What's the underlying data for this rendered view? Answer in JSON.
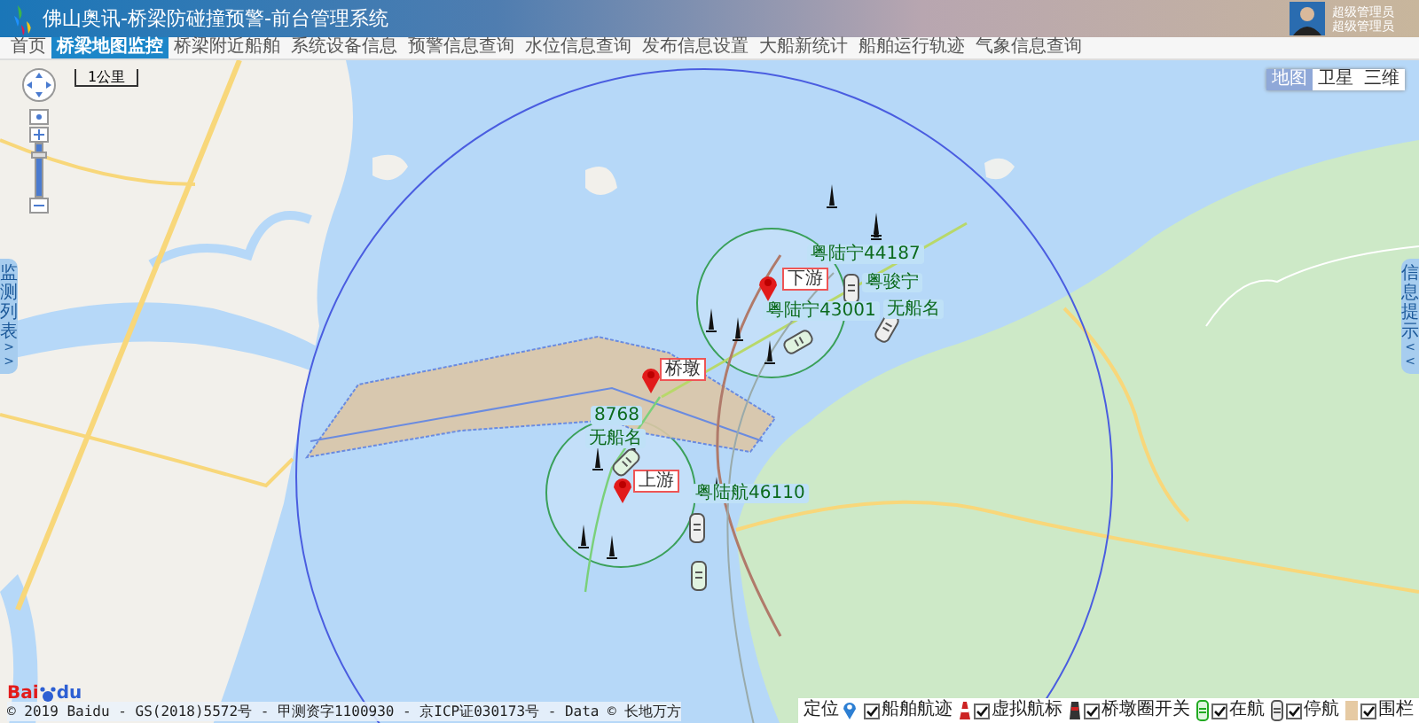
{
  "header": {
    "title": "佛山奥讯-桥梁防碰撞预警-前台管理系统",
    "user": {
      "name": "超级管理员",
      "role": "超级管理员"
    }
  },
  "nav": {
    "tabs": [
      {
        "label": "首页",
        "selected": false
      },
      {
        "label": "桥梁地图监控",
        "selected": true
      },
      {
        "label": "桥梁附近船舶",
        "selected": false
      },
      {
        "label": "系统设备信息",
        "selected": false
      },
      {
        "label": "预警信息查询",
        "selected": false
      },
      {
        "label": "水位信息查询",
        "selected": false
      },
      {
        "label": "发布信息设置",
        "selected": false
      },
      {
        "label": "大船新统计",
        "selected": false
      },
      {
        "label": "船舶运行轨迹",
        "selected": false
      },
      {
        "label": "气象信息查询",
        "selected": false
      }
    ]
  },
  "map": {
    "map_types": [
      {
        "label": "地图",
        "selected": true
      },
      {
        "label": "卫星",
        "selected": false
      },
      {
        "label": "三维",
        "selected": false
      }
    ],
    "scale": "1公里",
    "left_panel_tab": {
      "label": "监测列表",
      "arrow": ">>"
    },
    "right_panel_tab": {
      "label": "信息提示",
      "arrow": "<<"
    },
    "markers": [
      {
        "label": "下游"
      },
      {
        "label": "桥墩"
      },
      {
        "label": "上游"
      }
    ],
    "ship_labels": [
      "粤陆宁44187",
      "粤骏宁",
      "粤陆宁43001",
      "无船名",
      "8768",
      "无船名",
      "粤陆航46110"
    ],
    "logo": {
      "left": "Bai",
      "right": "du"
    },
    "copyright": "© 2019 Baidu - GS(2018)5572号 - 甲测资字1100930 - 京ICP证030173号 - Data © 长地万方"
  },
  "legend": [
    {
      "kind": "locate",
      "label": "定位"
    },
    {
      "kind": "track",
      "label": "船舶航迹",
      "checked": true
    },
    {
      "kind": "beacon",
      "label": "虚拟航标",
      "checked": true
    },
    {
      "kind": "pier",
      "label": "桥墩圈开关",
      "checked": true
    },
    {
      "kind": "sailing",
      "label": "在航",
      "checked": true
    },
    {
      "kind": "moored",
      "label": "停航",
      "checked": true
    },
    {
      "kind": "fence",
      "label": "围栏",
      "checked": true
    }
  ]
}
